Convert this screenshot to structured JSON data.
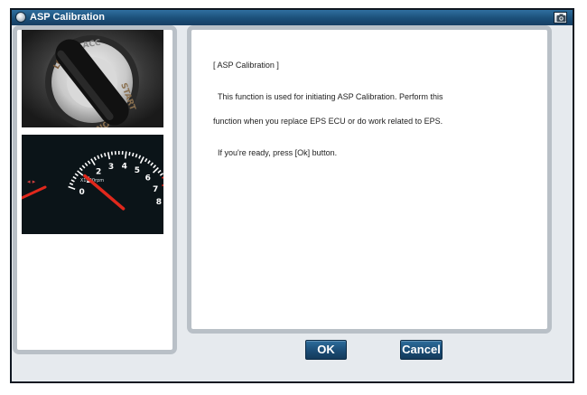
{
  "window": {
    "title": "ASP Calibration"
  },
  "message": {
    "heading": "[ ASP Calibration ]",
    "line1": "This function is used for initiating ASP Calibration. Perform this",
    "line2": "function when you replace EPS ECU or do work related to EPS.",
    "line3": "If you're ready, press [Ok] button."
  },
  "images": {
    "ignition": {
      "key_text": [
        "LOCK",
        "ACC",
        "START",
        "ON"
      ]
    },
    "tachometer": {
      "unit_label": "X1000rpm",
      "ticks": [
        "0",
        "1",
        "2",
        "3",
        "4",
        "5",
        "6",
        "7",
        "8"
      ],
      "needle_value": 1
    }
  },
  "buttons": {
    "ok_label": "OK",
    "cancel_label": "Cancel"
  },
  "colors": {
    "titlebar": "#1b4f79",
    "button": "#1a4a72",
    "panel_border": "#b9c0c7",
    "needle": "#e0281c"
  }
}
